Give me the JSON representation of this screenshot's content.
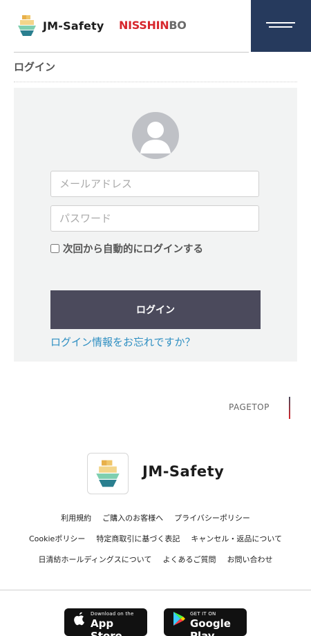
{
  "header": {
    "brand_name": "JM-Safety",
    "partner_logo_red": "NISSHIN",
    "partner_logo_gray": "BO",
    "menu_icon": "hamburger-icon"
  },
  "page": {
    "title": "ログイン"
  },
  "login": {
    "avatar_icon": "user-avatar-icon",
    "email_placeholder": "メールアドレス",
    "email_value": "",
    "password_placeholder": "パスワード",
    "password_value": "",
    "remember_label": "次回から自動的にログインする",
    "remember_checked": false,
    "submit_label": "ログイン",
    "forgot_link": "ログイン情報をお忘れですか？"
  },
  "pagetop": {
    "label": "PAGETOP"
  },
  "footer": {
    "brand_name": "JM-Safety",
    "links_row1": [
      "利用規約",
      "ご購入のお客様へ",
      "プライバシーポリシー"
    ],
    "links_row2": [
      "Cookieポリシー",
      "特定商取引に基づく表記",
      "キャンセル・返品について"
    ],
    "links_row3": [
      "日清紡ホールディングスについて",
      "よくあるご質問",
      "お問い合わせ"
    ],
    "appstore_small": "Download on the",
    "appstore_big": "App Store",
    "googleplay_small": "GET IT ON",
    "googleplay_big": "Google Play"
  },
  "colors": {
    "menu_bg": "#263a5d",
    "button_bg": "#4b4a5c",
    "link": "#2f8fc2",
    "panel_bg": "#f2f3f3",
    "partner_red": "#d7262c"
  }
}
